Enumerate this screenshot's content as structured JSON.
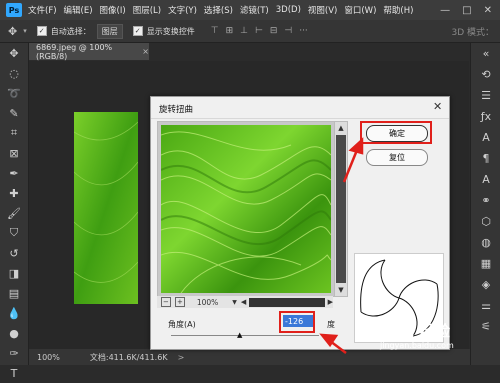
{
  "menubar": {
    "logo": "Ps",
    "items": [
      "文件(F)",
      "编辑(E)",
      "图像(I)",
      "图层(L)",
      "文字(Y)",
      "选择(S)",
      "滤镜(T)",
      "3D(D)",
      "视图(V)",
      "窗口(W)",
      "帮助(H)"
    ],
    "minimize": "—",
    "maximize": "□",
    "close": "✕"
  },
  "options": {
    "auto_select_label": "自动选择：",
    "auto_select_value": "图层",
    "show_transform_label": "显示变换控件",
    "more": "···",
    "mode_3d": "3D 模式："
  },
  "document": {
    "tab": "6869.jpeg @ 100%(RGB/8)",
    "tab_close": "×"
  },
  "status": {
    "zoom": "100%",
    "doc_info": "文档:411.6K/411.6K",
    "arrow": ">"
  },
  "dialog": {
    "title": "旋转扭曲",
    "close": "✕",
    "ok_label": "确定",
    "reset_label": "复位",
    "zoom_minus": "−",
    "zoom_plus": "+",
    "zoom_value": "100%",
    "angle_label": "角度(A)",
    "angle_value": "-126",
    "angle_unit": "度"
  },
  "watermark": {
    "brand": "Bai 经验",
    "url": "jingyan.baidu.com"
  },
  "colors": {
    "highlight": "#e0201b",
    "accent": "#31a8ff"
  }
}
